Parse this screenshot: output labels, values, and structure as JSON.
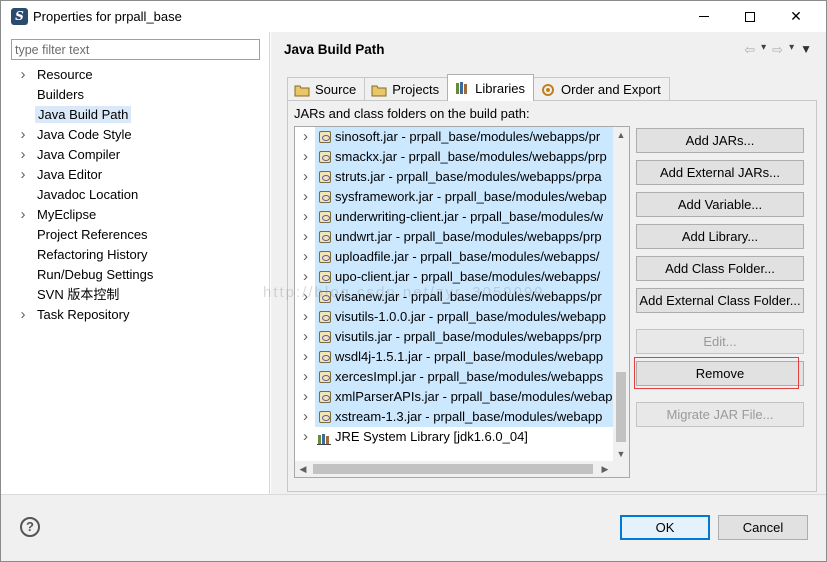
{
  "window": {
    "title": "Properties for prpall_base"
  },
  "filter": {
    "placeholder": "type filter text"
  },
  "tree": [
    {
      "label": "Resource",
      "expandable": true
    },
    {
      "label": "Builders",
      "expandable": false
    },
    {
      "label": "Java Build Path",
      "expandable": false,
      "selected": true
    },
    {
      "label": "Java Code Style",
      "expandable": true
    },
    {
      "label": "Java Compiler",
      "expandable": true
    },
    {
      "label": "Java Editor",
      "expandable": true
    },
    {
      "label": "Javadoc Location",
      "expandable": false
    },
    {
      "label": "MyEclipse",
      "expandable": true
    },
    {
      "label": "Project References",
      "expandable": false
    },
    {
      "label": "Refactoring History",
      "expandable": false
    },
    {
      "label": "Run/Debug Settings",
      "expandable": false
    },
    {
      "label": "SVN 版本控制",
      "expandable": false
    },
    {
      "label": "Task Repository",
      "expandable": true
    }
  ],
  "page": {
    "title": "Java Build Path"
  },
  "tabs": [
    {
      "label": "Source",
      "active": false
    },
    {
      "label": "Projects",
      "active": false
    },
    {
      "label": "Libraries",
      "active": true
    },
    {
      "label": "Order and Export",
      "active": false
    }
  ],
  "panel": {
    "label": "JARs and class folders on the build path:"
  },
  "entries": [
    "sinosoft.jar - prpall_base/modules/webapps/pr",
    "smackx.jar - prpall_base/modules/webapps/prp",
    "struts.jar - prpall_base/modules/webapps/prpa",
    "sysframework.jar - prpall_base/modules/webap",
    "underwriting-client.jar - prpall_base/modules/w",
    "undwrt.jar - prpall_base/modules/webapps/prp",
    "uploadfile.jar - prpall_base/modules/webapps/",
    "upo-client.jar - prpall_base/modules/webapps/",
    "visanew.jar - prpall_base/modules/webapps/pr",
    "visutils-1.0.0.jar - prpall_base/modules/webapp",
    "visutils.jar - prpall_base/modules/webapps/prp",
    "wsdl4j-1.5.1.jar - prpall_base/modules/webapp",
    "xercesImpl.jar - prpall_base/modules/webapps",
    "xmlParserAPIs.jar - prpall_base/modules/webap",
    "xstream-1.3.jar - prpall_base/modules/webapp"
  ],
  "jre_entry": "JRE System Library [jdk1.6.0_04]",
  "buttons": {
    "add_jars": "Add JARs...",
    "add_external_jars": "Add External JARs...",
    "add_variable": "Add Variable...",
    "add_library": "Add Library...",
    "add_class_folder": "Add Class Folder...",
    "add_external_class_folder": "Add External Class Folder...",
    "edit": "Edit...",
    "remove": "Remove",
    "migrate_jar": "Migrate JAR File..."
  },
  "dialog": {
    "ok": "OK",
    "cancel": "Cancel"
  },
  "watermark": "http://blog.csdn.net/zyr_3059099",
  "colors": {
    "selection": "#cce8ff",
    "highlight": "#e04040",
    "default_button_border": "#0078d7"
  }
}
